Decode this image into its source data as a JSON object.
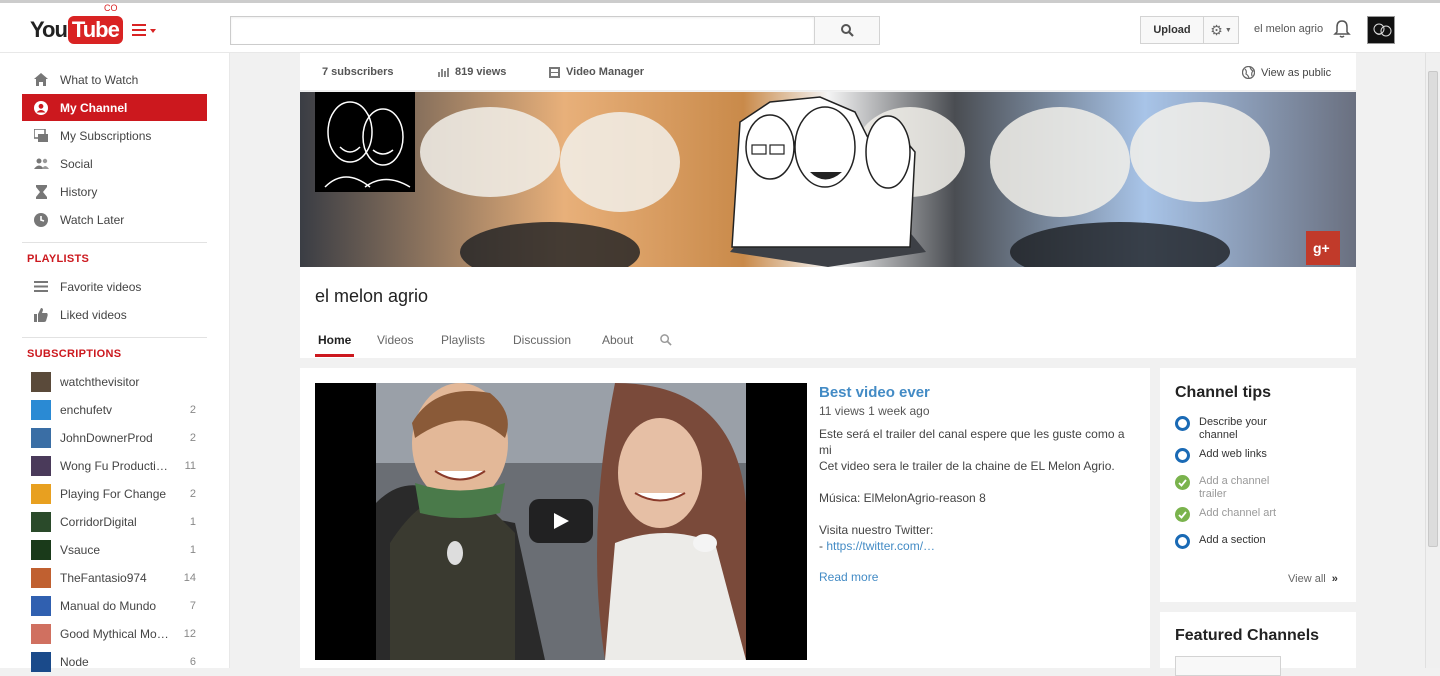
{
  "header": {
    "logo_you": "You",
    "logo_tube": "Tube",
    "logo_region": "CO",
    "search_placeholder": "",
    "upload_label": "Upload",
    "username": "el melon agrio"
  },
  "sidebar": {
    "nav": [
      {
        "label": "What to Watch",
        "icon": "home-icon"
      },
      {
        "label": "My Channel",
        "icon": "user-icon",
        "active": true
      },
      {
        "label": "My Subscriptions",
        "icon": "subscriptions-icon"
      },
      {
        "label": "Social",
        "icon": "social-icon"
      },
      {
        "label": "History",
        "icon": "hourglass-icon"
      },
      {
        "label": "Watch Later",
        "icon": "clock-icon"
      }
    ],
    "playlists_title": "PLAYLISTS",
    "playlists": [
      {
        "label": "Favorite videos",
        "icon": "list-icon"
      },
      {
        "label": "Liked videos",
        "icon": "thumbs-up-icon"
      }
    ],
    "subscriptions_title": "SUBSCRIPTIONS",
    "subscriptions": [
      {
        "label": "watchthevisitor",
        "count": "",
        "color": "#5a4a3a"
      },
      {
        "label": "enchufetv",
        "count": "2",
        "color": "#2a8ad4"
      },
      {
        "label": "JohnDownerProd",
        "count": "2",
        "color": "#3a6ea5"
      },
      {
        "label": "Wong Fu Producti…",
        "count": "11",
        "color": "#4a3a5a"
      },
      {
        "label": "Playing For Change",
        "count": "2",
        "color": "#e8a020"
      },
      {
        "label": "CorridorDigital",
        "count": "1",
        "color": "#2a4a2a"
      },
      {
        "label": "Vsauce",
        "count": "1",
        "color": "#1a3a1a"
      },
      {
        "label": "TheFantasio974",
        "count": "14",
        "color": "#c06030"
      },
      {
        "label": "Manual do Mundo",
        "count": "7",
        "color": "#3060b0"
      },
      {
        "label": "Good Mythical Mo…",
        "count": "12",
        "color": "#d07060"
      },
      {
        "label": "Node",
        "count": "6",
        "color": "#1a4a8a"
      }
    ]
  },
  "stats": {
    "subscribers": "7 subscribers",
    "views": "819 views",
    "video_manager": "Video Manager",
    "view_as_public": "View as public"
  },
  "channel": {
    "name": "el melon agrio",
    "tabs": [
      "Home",
      "Videos",
      "Playlists",
      "Discussion",
      "About"
    ]
  },
  "featured_video": {
    "title": "Best video ever",
    "meta": "11 views  1 week ago",
    "description": "Este será el trailer del canal espere que les guste como a mi\nCet video sera le trailer de la chaine de EL Melon Agrio.\n\nMúsica: ElMelonAgrio-reason 8\n\nVisita nuestro Twitter:",
    "link_prefix": "- ",
    "link_text": "https://twitter.com/…",
    "read_more": "Read more"
  },
  "tips": {
    "title": "Channel tips",
    "items": [
      {
        "label": "Describe your channel",
        "done": false
      },
      {
        "label": "Add web links",
        "done": false
      },
      {
        "label": "Add a channel trailer",
        "done": true
      },
      {
        "label": "Add channel art",
        "done": true
      },
      {
        "label": "Add a section",
        "done": false
      }
    ],
    "view_all": "View all"
  },
  "featured_channels": {
    "title": "Featured Channels"
  }
}
